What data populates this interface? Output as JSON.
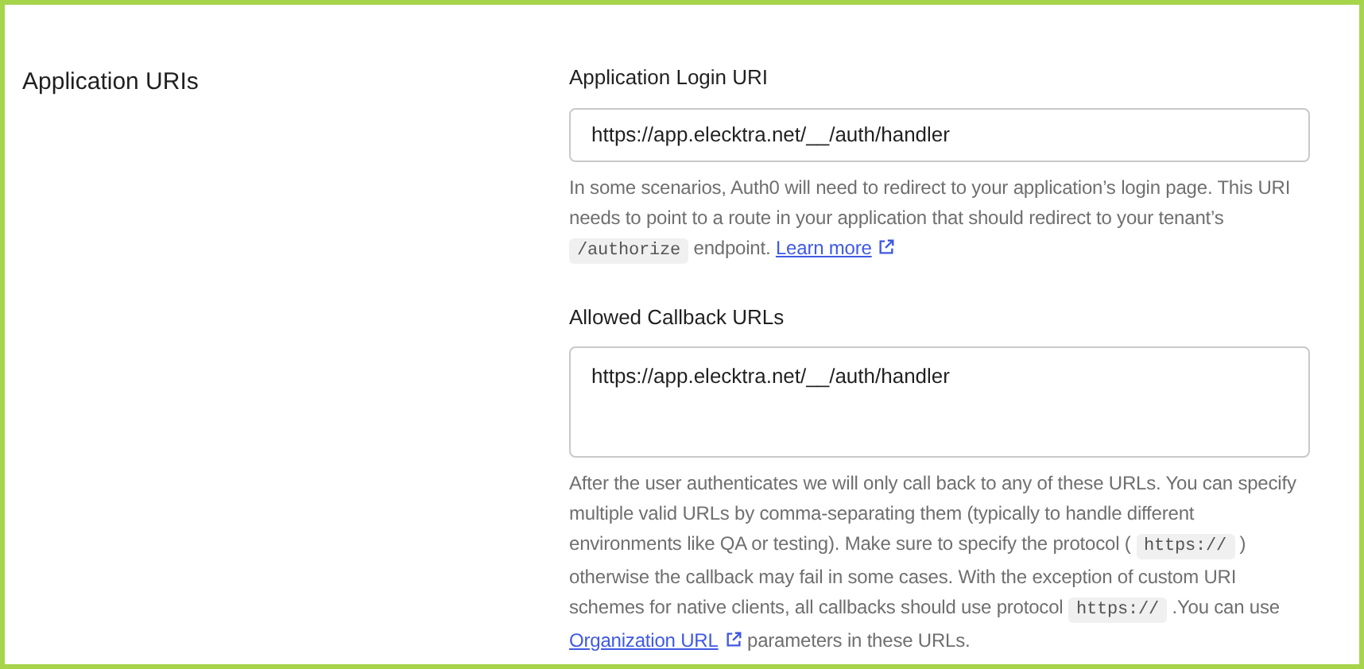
{
  "section": {
    "title": "Application URIs"
  },
  "fields": [
    {
      "kind": "input",
      "label": "Application Login URI",
      "value": "https://app.elecktra.net/__/auth/handler",
      "help": [
        {
          "kind": "text",
          "text": "In some scenarios, Auth0 will need to redirect to your application’s login page. This URI needs to point to a route in your application that should redirect to your tenant’s "
        },
        {
          "kind": "code",
          "text": "/authorize"
        },
        {
          "kind": "text",
          "text": " endpoint. "
        },
        {
          "kind": "link",
          "text": "Learn more"
        }
      ]
    },
    {
      "kind": "textarea",
      "label": "Allowed Callback URLs",
      "value": "https://app.elecktra.net/__/auth/handler",
      "help": [
        {
          "kind": "text",
          "text": "After the user authenticates we will only call back to any of these URLs. You can specify multiple valid URLs by comma-separating them (typically to handle different environments like QA or testing). Make sure to specify the protocol ( "
        },
        {
          "kind": "code",
          "text": "https://"
        },
        {
          "kind": "text",
          "text": " ) otherwise the callback may fail in some cases. With the exception of custom URI schemes for native clients, all callbacks should use protocol "
        },
        {
          "kind": "code",
          "text": "https://"
        },
        {
          "kind": "text",
          "text": " .You can use "
        },
        {
          "kind": "link",
          "text": "Organization URL"
        },
        {
          "kind": "text",
          "text": " parameters in these URLs."
        }
      ]
    }
  ]
}
